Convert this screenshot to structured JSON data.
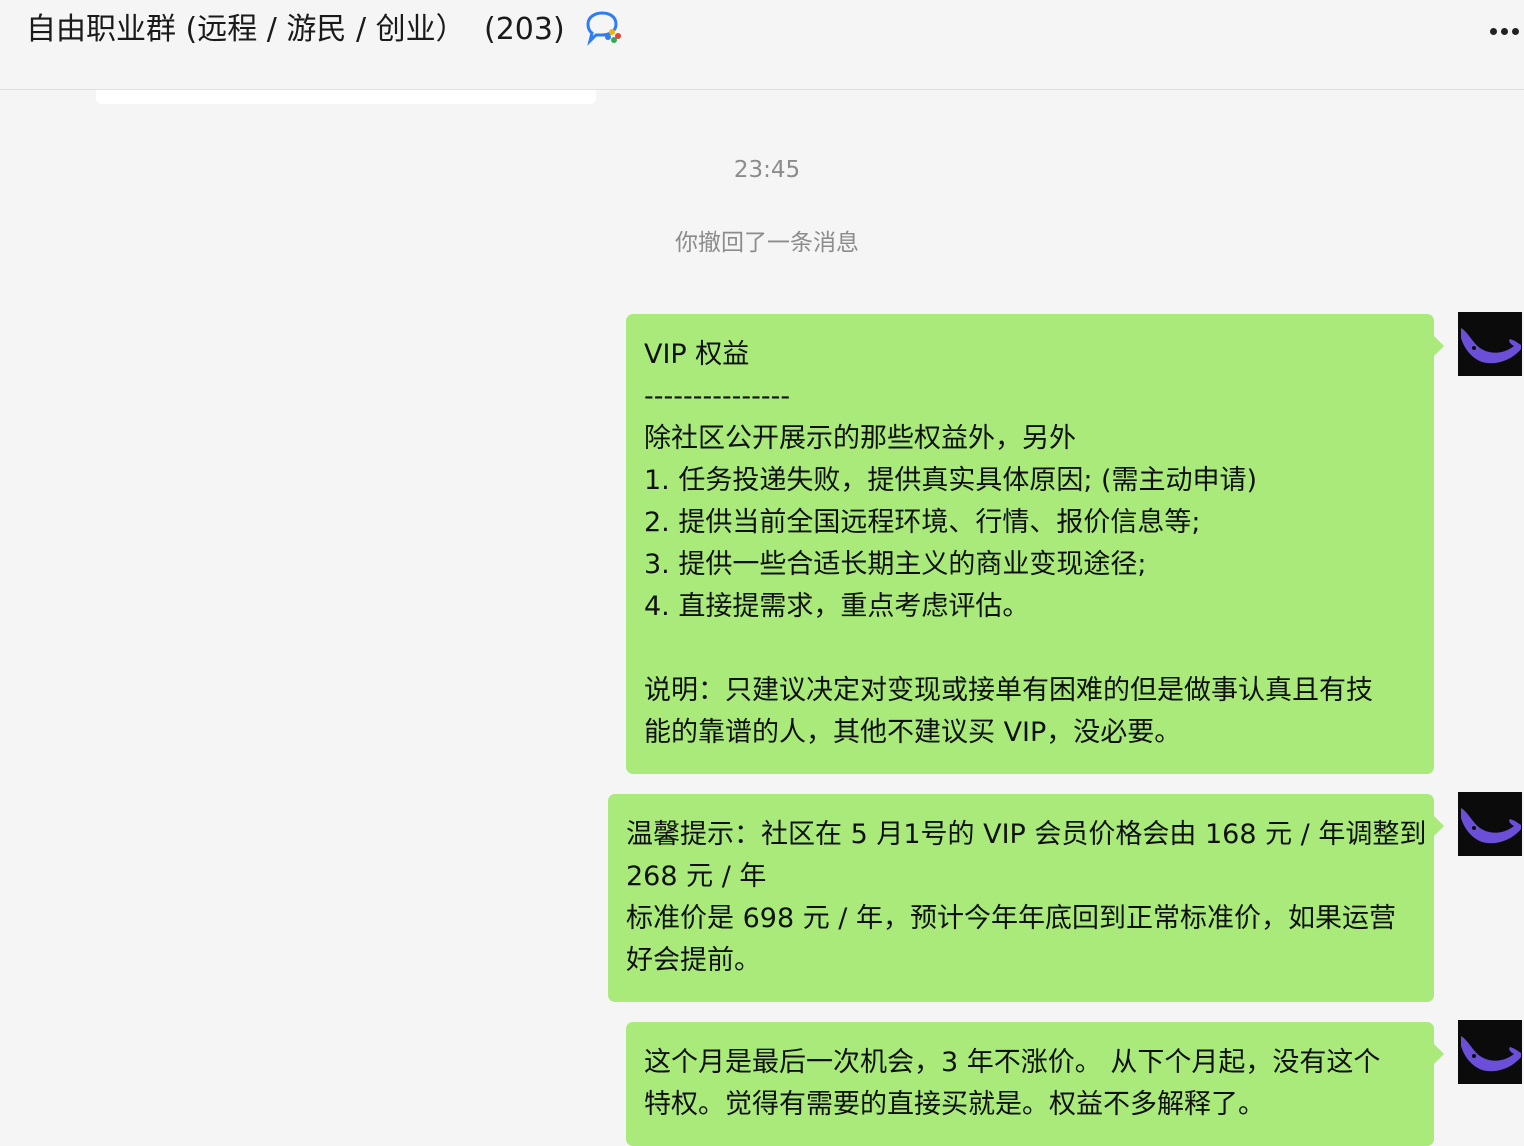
{
  "header": {
    "title": "自由职业群 (远程 / 游民 / 创业）",
    "member_count": "(203)",
    "chat_icon": "chat-bubble-icon",
    "more_icon": "more-dots-icon"
  },
  "chat": {
    "timestamp": "23:45",
    "system_notice": "你撤回了一条消息",
    "messages": [
      {
        "lines": [
          "VIP 权益",
          "---------------",
          "除社区公开展示的那些权益外，另外",
          "1. 任务投递失败，提供真实具体原因; (需主动申请)",
          "2. 提供当前全国远程环境、行情、报价信息等;",
          "3. 提供一些合适长期主义的商业变现途径;",
          "4. 直接提需求，重点考虑评估。",
          "",
          "说明：只建议决定对变现或接单有困难的但是做事认真且有技",
          "能的靠谱的人，其他不建议买 VIP，没必要。"
        ]
      },
      {
        "lines": [
          "温馨提示：社区在 5 月1号的 VIP 会员价格会由 168 元 / 年调整到",
          "268 元 / 年",
          "标准价是 698 元 / 年，预计今年年底回到正常标准价，如果运营",
          "好会提前。"
        ]
      },
      {
        "lines": [
          "这个月是最后一次机会，3 年不涨价。 从下个月起，没有这个",
          "特权。觉得有需要的直接买就是。权益不多解释了。"
        ]
      }
    ]
  },
  "colors": {
    "bubble": "#a9ea7a",
    "background": "#f5f5f5",
    "avatar_bg": "#0b0b0b",
    "avatar_accent": "#6b4fd8"
  }
}
